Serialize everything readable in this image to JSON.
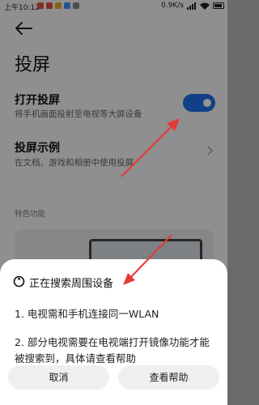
{
  "status_bar": {
    "time": "上午10:12",
    "network_speed": "0.9K/s",
    "mini_icon_colors": [
      "#e94b3c",
      "#e94b3c",
      "#f2a51f",
      "#3f8ef0",
      "#888888"
    ]
  },
  "page": {
    "title": "投屏",
    "cast_row": {
      "title": "打开投屏",
      "subtitle": "将手机画面投射至电视等大屏设备",
      "toggle_on": true
    },
    "example_row": {
      "title": "投屏示例",
      "subtitle": "在文档、游戏和相册中使用投屏"
    },
    "features_label": "特色功能"
  },
  "sheet": {
    "status": "正在搜索周围设备",
    "instructions": [
      "1. 电视需和手机连接同一WLAN",
      "2. 部分电视需要在电视端打开镜像功能才能被搜索到，具体请查看帮助"
    ],
    "buttons": {
      "cancel": "取消",
      "help": "查看帮助"
    }
  },
  "colors": {
    "accent": "#1f6ee8",
    "annotation": "#e53935",
    "sheet_bg": "#ffffff"
  },
  "icons": {
    "back": "back-arrow-icon",
    "chevron": "chevron-right-icon",
    "spinner": "loading-spinner-icon",
    "wifi": "wifi-icon",
    "battery": "battery-icon"
  }
}
